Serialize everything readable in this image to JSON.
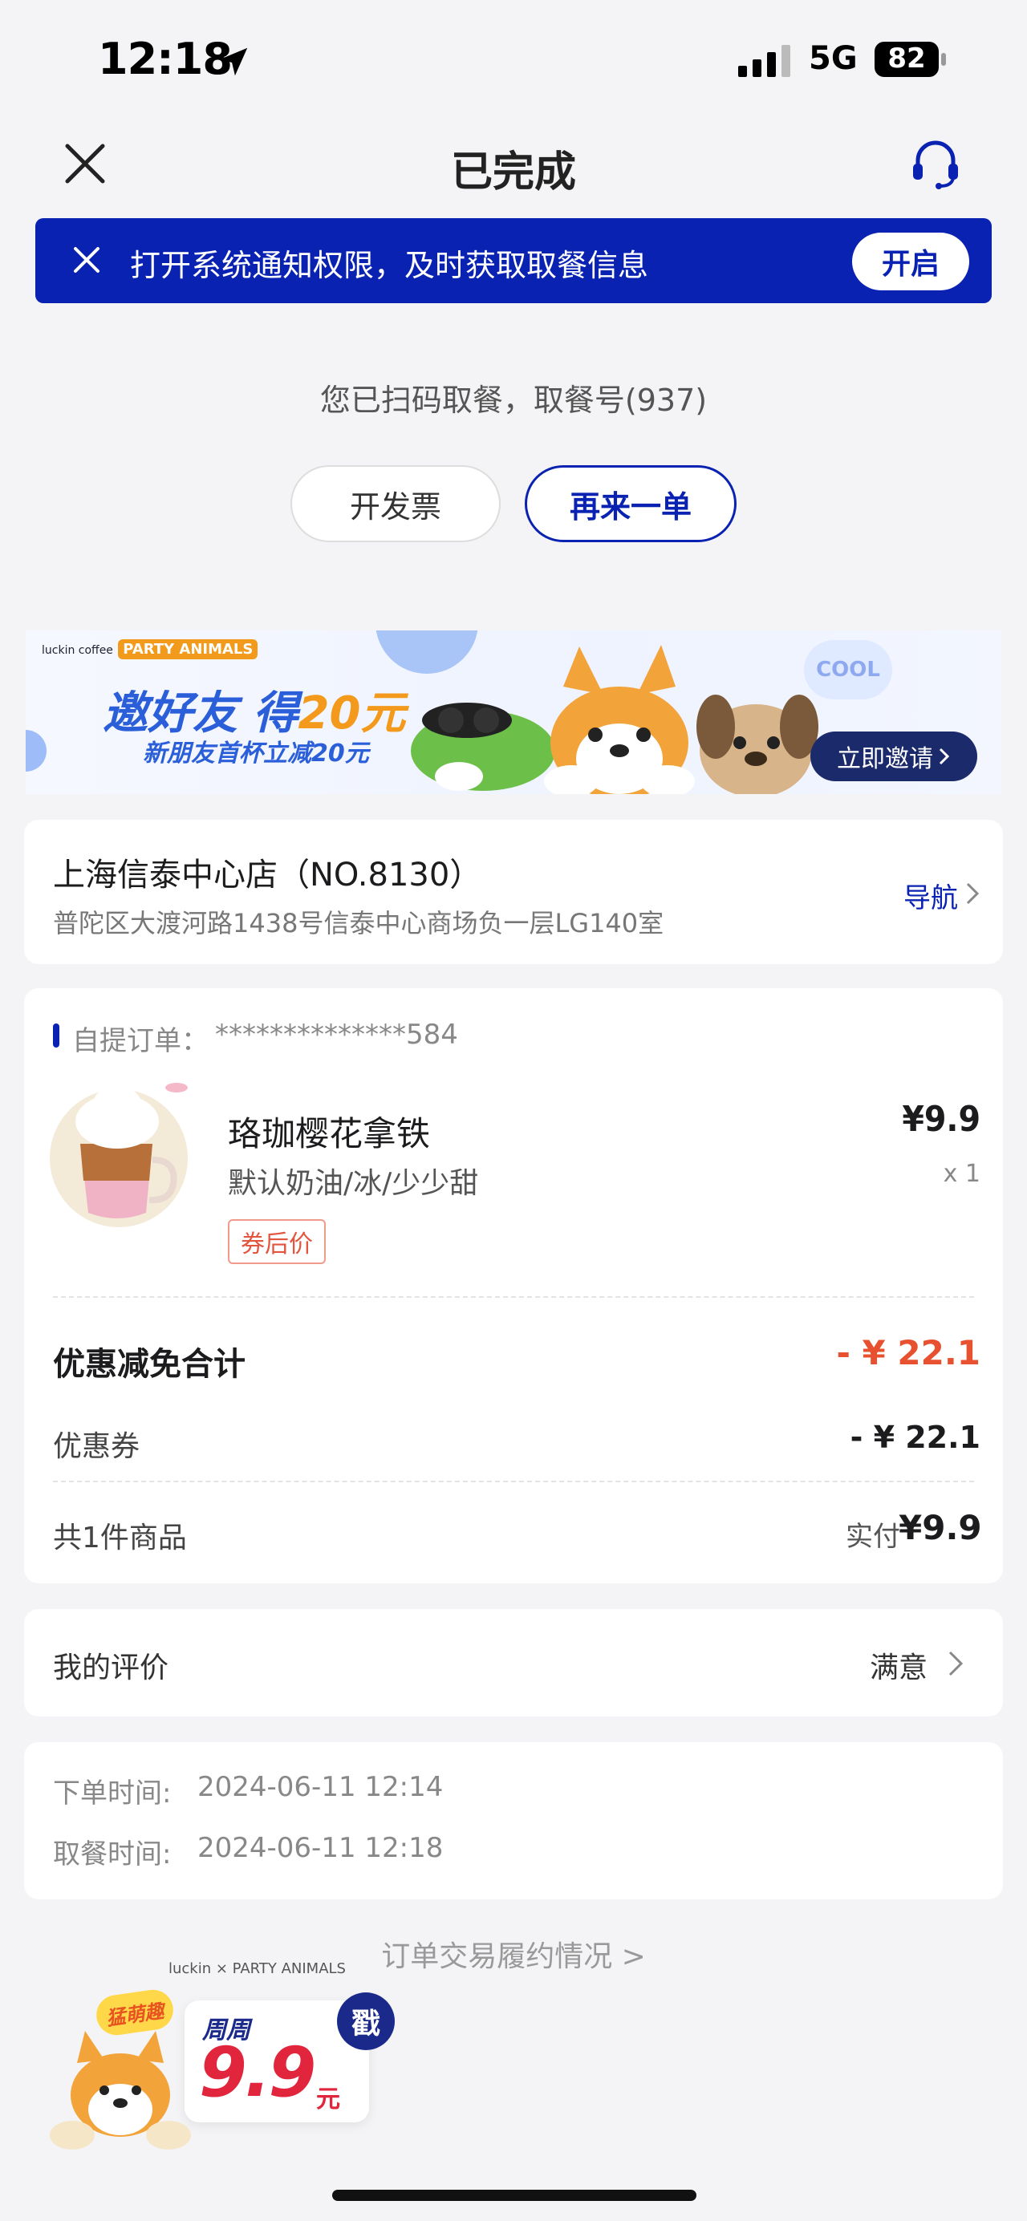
{
  "status_bar": {
    "time": "12:18",
    "network": "5G",
    "battery": "82"
  },
  "header": {
    "title": "已完成"
  },
  "notify_banner": {
    "text": "打开系统通知权限，及时获取取餐信息",
    "button": "开启",
    "bg_color": "#0a22b1"
  },
  "pickup_info": "您已扫码取餐，取餐号(937)",
  "actions": {
    "invoice": "开发票",
    "reorder": "再来一单"
  },
  "promo_banner": {
    "brand": "luckin coffee",
    "collab": "PARTY ANIMALS",
    "title_prefix": "邀好友 得",
    "title_amount": "20元",
    "subtitle": "新朋友首杯立减20元",
    "bubble": "COOL",
    "button": "立即邀请"
  },
  "store": {
    "name": "上海信泰中心店（NO.8130）",
    "address": "普陀区大渡河路1438号信泰中心商场负一层LG140室",
    "nav": "导航"
  },
  "order": {
    "label": "自提订单：",
    "id": "**************584",
    "product": {
      "name": "珞珈樱花拿铁",
      "spec": "默认奶油/冰/少少甜",
      "tag": "券后价",
      "price": "¥9.9",
      "qty": "x 1"
    },
    "discount_title": "优惠减免合计",
    "discount_total": "- ¥ 22.1",
    "coupon_label": "优惠券",
    "coupon_value": "- ¥ 22.1",
    "items_count": "共1件商品",
    "paid_label": "实付",
    "paid_value": "¥9.9"
  },
  "review": {
    "label": "我的评价",
    "value": "满意"
  },
  "times": {
    "order_label": "下单时间:",
    "order_value": "2024-06-11 12:14",
    "pickup_label": "取餐时间:",
    "pickup_value": "2024-06-11 12:18"
  },
  "fulfillment_link": "订单交易履约情况 >",
  "float_promo": {
    "brand": "luckin × PARTY ANIMALS",
    "tag": "猛萌趣",
    "week": "周周",
    "price": "9.9",
    "unit": "元",
    "stamp": "戳"
  },
  "colors": {
    "accent": "#0a22b1",
    "discount": "#e8512f",
    "background": "#f4f4f6"
  }
}
